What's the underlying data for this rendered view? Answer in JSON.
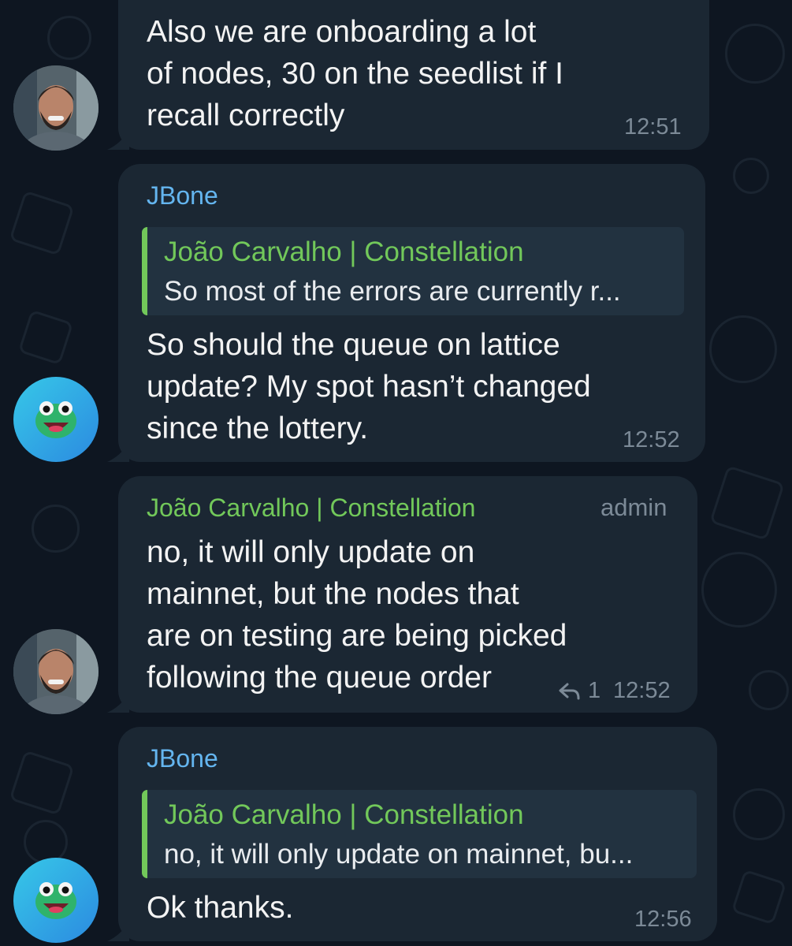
{
  "messages": [
    {
      "lines": [
        "Also we are onboarding a lot",
        "of nodes, 30 on the seedlist if I",
        "recall correctly"
      ],
      "time": "12:51"
    },
    {
      "sender": "JBone",
      "quote": {
        "name": "João Carvalho | Constellation",
        "text": "So most of the errors are currently r..."
      },
      "lines": [
        "So should the queue on lattice",
        "update? My spot hasn’t changed",
        "since the lottery."
      ],
      "time": "12:52"
    },
    {
      "sender": "João Carvalho | Constellation",
      "badge": "admin",
      "lines": [
        "no, it will only update on",
        "mainnet, but the nodes that",
        "are on testing are being picked",
        "following the queue order"
      ],
      "replies": "1",
      "time": "12:52"
    },
    {
      "sender": "JBone",
      "quote": {
        "name": "João Carvalho | Constellation",
        "text": "no, it will only update on mainnet, bu..."
      },
      "lines": [
        "Ok thanks."
      ],
      "time": "12:56"
    }
  ],
  "icons": {
    "reply": "reply-arrow-icon"
  },
  "colors": {
    "background": "#0e1621",
    "bubble": "#1b2733",
    "sender_blue": "#64b5ef",
    "sender_green": "#72c85a",
    "meta": "#7c8a97"
  }
}
